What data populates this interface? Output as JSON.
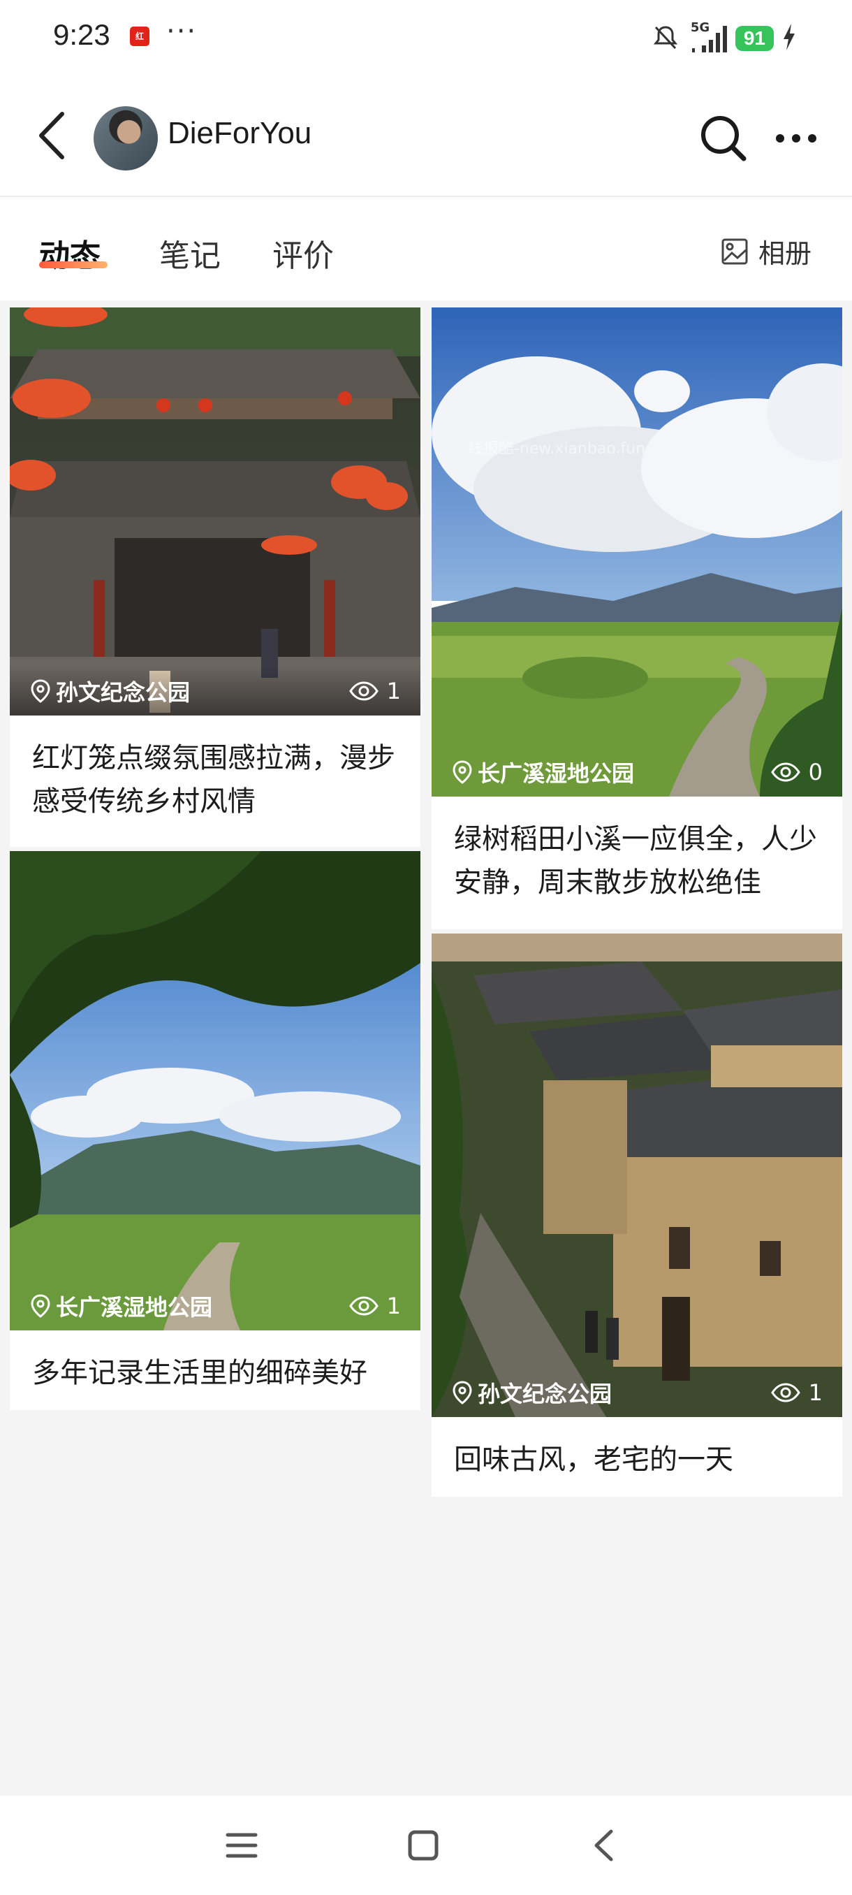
{
  "status_bar": {
    "time": "9:23",
    "app_icon_label": "红",
    "more_indicator": "···",
    "network": "5G",
    "battery": "91"
  },
  "header": {
    "username": "DieForYou",
    "icons": [
      "back-icon",
      "search-icon",
      "more-icon"
    ]
  },
  "tabs": [
    {
      "label": "动态",
      "active": true
    },
    {
      "label": "笔记",
      "active": false
    },
    {
      "label": "评价",
      "active": false
    }
  ],
  "album_label": "相册",
  "watermark": "线报酷-new.xianbao.fun",
  "posts": [
    {
      "location": "孙文纪念公园",
      "views": "1",
      "title": "红灯笼点缀氛围感拉满，漫步感受传统乡村风情"
    },
    {
      "location": "长广溪湿地公园",
      "views": "0",
      "title": "绿树稻田小溪一应俱全，人少安静，周末散步放松绝佳"
    },
    {
      "location": "长广溪湿地公园",
      "views": "1",
      "title": "多年记录生活里的细碎美好"
    },
    {
      "location": "孙文纪念公园",
      "views": "1",
      "title": "回味古风，老宅的一天"
    }
  ],
  "colors": {
    "accent_underline_start": "#ff5a3c",
    "accent_underline_end": "#ffb36b",
    "battery": "#35c35a",
    "background": "#f4f4f4"
  }
}
